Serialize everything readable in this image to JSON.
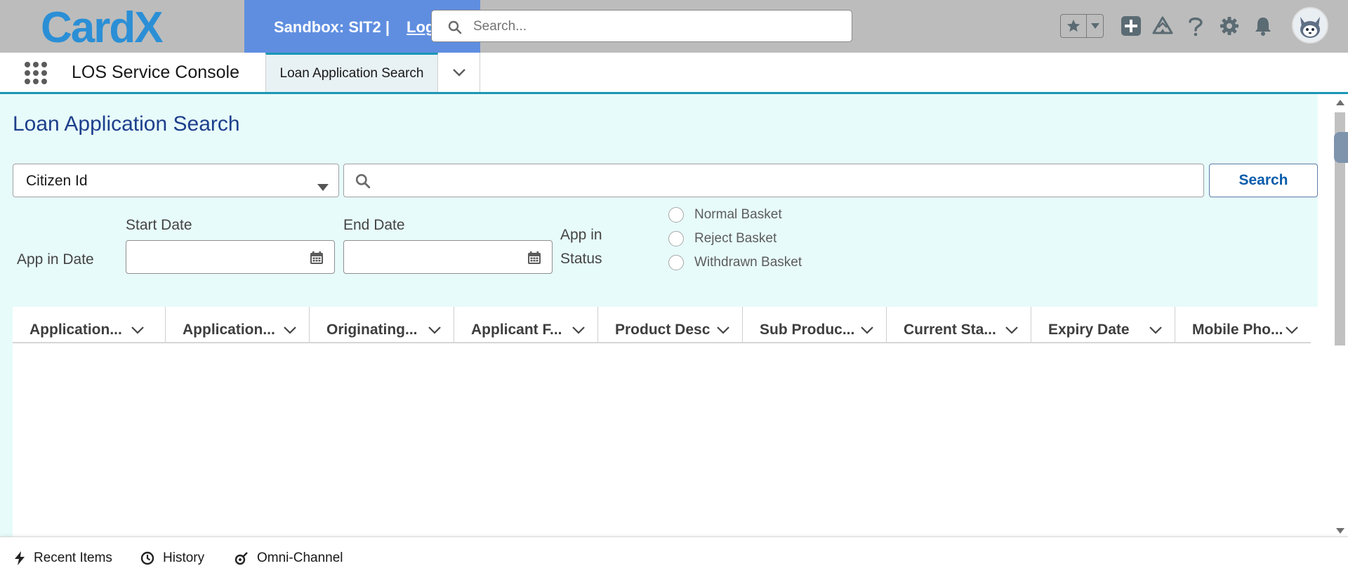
{
  "header": {
    "logo_text": "CardX",
    "sandbox_text": "Sandbox: SIT2 |",
    "logout_text": "Log",
    "search_placeholder": "Search..."
  },
  "nav": {
    "app_name": "LOS Service Console",
    "tab_label": "Loan Application Search"
  },
  "page": {
    "title": "Loan Application Search",
    "search_type": "Citizen Id",
    "search_value": "",
    "search_button": "Search",
    "app_in_date_label": "App in Date",
    "start_date_label": "Start Date",
    "end_date_label": "End Date",
    "start_date_value": "",
    "end_date_value": "",
    "app_in_status_label_1": "App in",
    "app_in_status_label_2": "Status",
    "status_options": [
      "Normal Basket",
      "Reject Basket",
      "Withdrawn Basket"
    ]
  },
  "table": {
    "columns": [
      "Application...",
      "Application...",
      "Originating...",
      "Applicant F...",
      "Product Desc",
      "Sub Produc...",
      "Current Sta...",
      "Expiry Date",
      "Mobile Pho..."
    ],
    "rows": []
  },
  "utility_bar": {
    "items": [
      "Recent Items",
      "History",
      "Omni-Channel"
    ]
  },
  "colors": {
    "header_bg": "#bcbcbc",
    "sandbox_bg": "#5f8ee0",
    "workspace_bg": "#e7fbfa",
    "title_color": "#1d3f8c",
    "accent": "#1b96b5"
  }
}
